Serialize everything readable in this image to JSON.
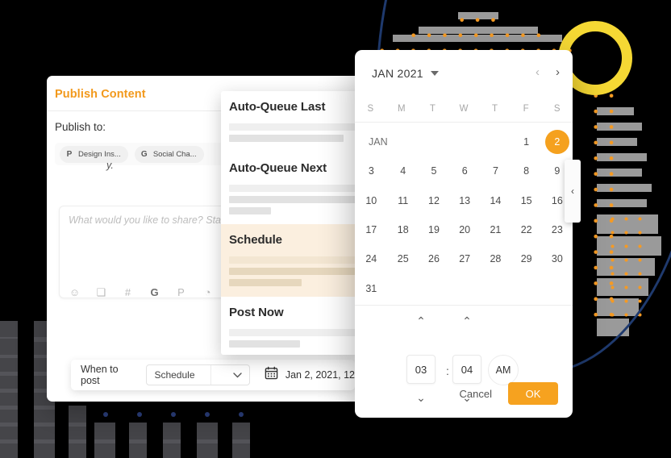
{
  "publish_panel": {
    "title": "Publish Content",
    "publish_to_label": "Publish to:",
    "chips": [
      {
        "icon": "pinterest-icon",
        "glyph": "P",
        "label": "Design Ins..."
      },
      {
        "icon": "google-icon",
        "glyph": "G",
        "label": "Social Cha..."
      }
    ],
    "compose_placeholder": "What would you like to share? Sta",
    "toolbar_icons": [
      "emoji-icon",
      "image-icon",
      "hashtag-icon",
      "google-icon",
      "pinterest-icon",
      "analytics-icon"
    ],
    "toolbar_glyphs": [
      "☺",
      "❑",
      "#",
      "G",
      "P",
      "◔"
    ],
    "bottom_bar": {
      "when_to_post_label": "When to post",
      "schedule_value": "Schedule",
      "chevron": "⌄",
      "date_icon": "calendar-icon",
      "date_text": "Jan 2, 2021, 12"
    }
  },
  "queue_menu": {
    "items": [
      {
        "label": "Auto-Queue Last",
        "highlighted": false,
        "skeletons": [
          "lite-full",
          "mid-wide"
        ]
      },
      {
        "label": "Auto-Queue Next",
        "highlighted": false,
        "skeletons": [
          "lite-full",
          "mid-full",
          "mid-short"
        ]
      },
      {
        "label": "Schedule",
        "highlighted": true,
        "skeletons": [
          "lite-full",
          "mid-full",
          "mid-medium"
        ]
      },
      {
        "label": "Post Now",
        "highlighted": false,
        "skeletons": [
          "lite-full",
          "mid-medium"
        ]
      }
    ],
    "fragment_text": "y."
  },
  "date_picker": {
    "month_label": "JAN 2021",
    "dropdown_caret": "caret-down-icon",
    "prev_arrow": "‹",
    "next_arrow": "›",
    "dow": [
      "S",
      "M",
      "T",
      "W",
      "T",
      "F",
      "S"
    ],
    "month_row_label": "JAN",
    "weeks": [
      [
        "JAN",
        "",
        "",
        "",
        "",
        "1",
        "2"
      ],
      [
        "3",
        "4",
        "5",
        "6",
        "7",
        "8",
        "9"
      ],
      [
        "10",
        "11",
        "12",
        "13",
        "14",
        "15",
        "16"
      ],
      [
        "17",
        "18",
        "19",
        "20",
        "21",
        "22",
        "23"
      ],
      [
        "24",
        "25",
        "26",
        "27",
        "28",
        "29",
        "30"
      ],
      [
        "31",
        "",
        "",
        "",
        "",
        "",
        ""
      ]
    ],
    "selected_day": "2",
    "time": {
      "hour": "03",
      "minute": "04",
      "separator": ":",
      "meridiem": "AM",
      "up_arrow": "⌃",
      "down_arrow": "⌄"
    },
    "cancel_label": "Cancel",
    "ok_label": "OK"
  },
  "carousel": {
    "prev_arrow": "‹"
  },
  "colors": {
    "accent_orange": "#F5A11E",
    "title_orange": "#F2991C",
    "highlight_cream": "#FBEFDF",
    "navy": "#1f3a6e",
    "yellow": "#F5D834",
    "dot_orange": "#F59A23"
  }
}
